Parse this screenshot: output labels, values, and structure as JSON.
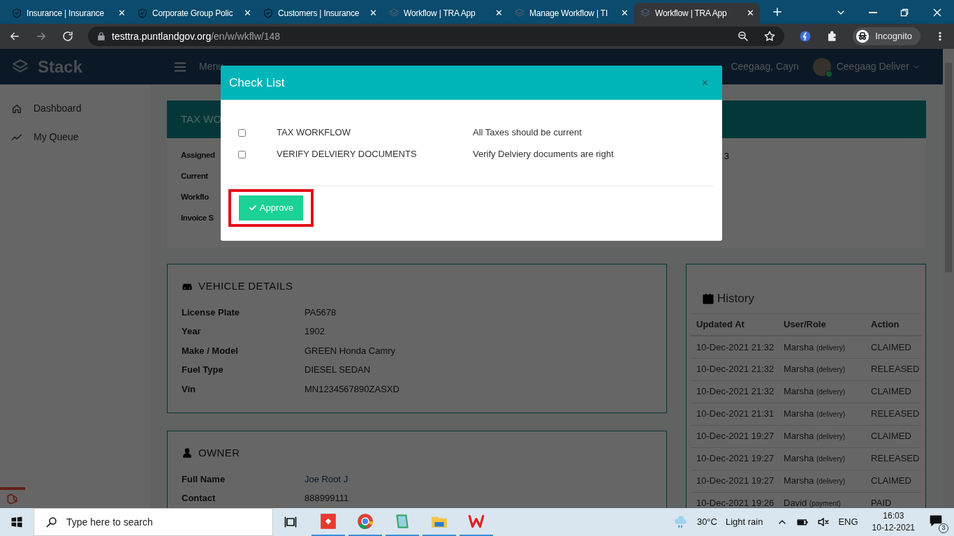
{
  "browser": {
    "tabs": [
      {
        "title": "Insurance | Insurance",
        "kind": "shield",
        "close": "✕",
        "selected": false
      },
      {
        "title": "Corporate Group Polic",
        "kind": "shield",
        "close": "✕",
        "selected": false
      },
      {
        "title": "Customers | Insurance",
        "kind": "shield",
        "close": "✕",
        "selected": false
      },
      {
        "title": "Workflow | TRA App",
        "kind": "layers",
        "close": "✕",
        "selected": false
      },
      {
        "title": "Manage Workflow | TI",
        "kind": "layers",
        "close": "✕",
        "selected": false
      },
      {
        "title": "Workflow | TRA App",
        "kind": "layers",
        "close": "✕",
        "selected": true
      }
    ],
    "url_host": "testtra.puntlandgov.org",
    "url_path": "/en/w/wkflw/148",
    "profile": "Incognito"
  },
  "app": {
    "logo": "Stack",
    "menu_label": "Menu",
    "user_name": "Ceegaag, Cayn",
    "account": "Ceegaag Deliver",
    "sidebar": [
      {
        "label": "Dashboard"
      },
      {
        "label": "My Queue"
      }
    ],
    "workflow_card": {
      "title": "TAX WO",
      "labels": [
        "Assigned",
        "Current",
        "Workflo",
        "Invoice S"
      ],
      "value_fragment": "3"
    },
    "vehicle": {
      "title": "VEHICLE DETAILS",
      "rows": [
        {
          "label": "License Plate",
          "value": "PA5678"
        },
        {
          "label": "Year",
          "value": "1902"
        },
        {
          "label": "Make / Model",
          "value": "GREEN Honda Camry"
        },
        {
          "label": "Fuel Type",
          "value": "DIESEL SEDAN"
        },
        {
          "label": "Vin",
          "value": "MN1234567890ZASXD"
        }
      ]
    },
    "owner": {
      "title": "OWNER",
      "rows": [
        {
          "label": "Full Name",
          "value": "Joe Root J",
          "link": true
        },
        {
          "label": "Contact",
          "value": "888999111",
          "link": false
        }
      ]
    },
    "history": {
      "title": "History",
      "columns": [
        "Updated At",
        "User/Role",
        "Action"
      ],
      "rows": [
        {
          "time": "10-Dec-2021 21:32",
          "user": "Marsha",
          "role": "(delivery)",
          "action": "CLAIMED"
        },
        {
          "time": "10-Dec-2021 21:32",
          "user": "Marsha",
          "role": "(delivery)",
          "action": "RELEASED"
        },
        {
          "time": "10-Dec-2021 21:32",
          "user": "Marsha",
          "role": "(delivery)",
          "action": "CLAIMED"
        },
        {
          "time": "10-Dec-2021 21:31",
          "user": "Marsha",
          "role": "(delivery)",
          "action": "RELEASED"
        },
        {
          "time": "10-Dec-2021 19:27",
          "user": "Marsha",
          "role": "(delivery)",
          "action": "CLAIMED"
        },
        {
          "time": "10-Dec-2021 19:27",
          "user": "Marsha",
          "role": "(delivery)",
          "action": "RELEASED"
        },
        {
          "time": "10-Dec-2021 19:27",
          "user": "Marsha",
          "role": "(delivery)",
          "action": "CLAIMED"
        },
        {
          "time": "10-Dec-2021 19:26",
          "user": "David",
          "role": "(payment)",
          "action": "PAID"
        }
      ]
    }
  },
  "modal": {
    "title": "Check List",
    "close": "×",
    "items": [
      {
        "name": "TAX WORKFLOW",
        "description": "All Taxes should be current",
        "checked": false
      },
      {
        "name": "VERIFY DELVIERY DOCUMENTS",
        "description": "Verify Delviery documents are right",
        "checked": false
      }
    ],
    "button": "Approve"
  },
  "taskbar": {
    "search_placeholder": "Type here to search",
    "temperature": "30°C",
    "weather": "Light rain",
    "language": "ENG",
    "time": "16:03",
    "date": "10-12-2021",
    "notifications": "3"
  }
}
